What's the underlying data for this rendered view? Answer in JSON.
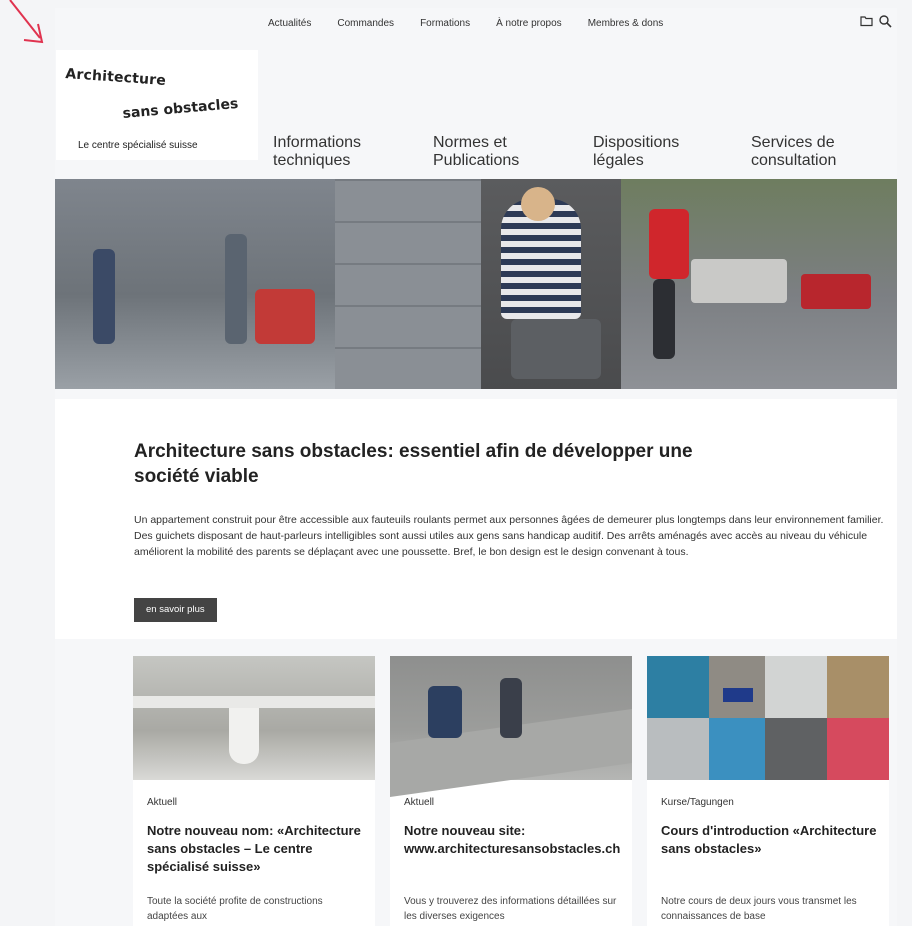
{
  "topnav": [
    "Actualités",
    "Commandes",
    "Formations",
    "À notre propos",
    "Membres & dons"
  ],
  "icons": [
    "folder-icon",
    "search-icon"
  ],
  "logo": {
    "line1": "Architecture",
    "line2": "sans obstacles",
    "tagline": "Le centre spécialisé suisse"
  },
  "mainnav": [
    {
      "line1": "Informations",
      "line2": "techniques"
    },
    {
      "line1": "Normes et",
      "line2": "Publications"
    },
    {
      "line1": "Dispositions",
      "line2": "légales"
    },
    {
      "line1": "Services de",
      "line2": "consultation"
    }
  ],
  "intro": {
    "title": "Architecture sans obstacles: essentiel afin de développer une société viable",
    "text": "Un appartement construit pour être accessible aux fauteuils roulants permet aux personnes âgées de demeurer plus longtemps dans leur environnement familier. Des guichets disposant de haut-parleurs intelligibles sont aussi utiles aux gens sans handicap auditif. Des arrêts aménagés avec accès au niveau du véhicule améliorent la mobilité des parents se déplaçant avec une poussette. Bref, le bon design est le design convenant à tous.",
    "button": "en savoir plus"
  },
  "cards": [
    {
      "category": "Aktuell",
      "title": "Notre nouveau nom: «Architecture sans obstacles – Le centre spécialisé suisse»",
      "text": "Toute la société profite de constructions adaptées aux"
    },
    {
      "category": "Aktuell",
      "title": "Notre nouveau site: www.architecturesansobstacles.ch",
      "text": "Vous y trouverez des informations détaillées sur les diverses exigences"
    },
    {
      "category": "Kurse/Tagungen",
      "title": "Cours d'introduction «Architecture sans obstacles»",
      "text": "Notre cours de deux jours vous transmet les connaissances de base"
    }
  ]
}
